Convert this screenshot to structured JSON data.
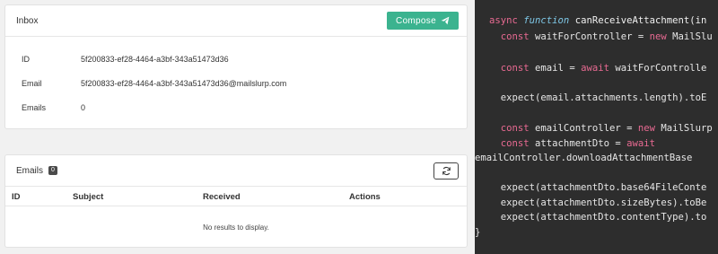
{
  "inbox": {
    "title": "Inbox",
    "compose_label": "Compose",
    "fields": [
      {
        "label": "ID",
        "value": "5f200833-ef28-4464-a3bf-343a51473d36"
      },
      {
        "label": "Email",
        "value": "5f200833-ef28-4464-a3bf-343a51473d36@mailslurp.com"
      },
      {
        "label": "Emails",
        "value": "0"
      }
    ]
  },
  "emails": {
    "title": "Emails",
    "count": "0",
    "columns": [
      "ID",
      "Subject",
      "Received",
      "Actions"
    ],
    "empty_text": "No results to display."
  },
  "code": {
    "lines": [
      "async function canReceiveAttachment(in",
      "  const waitForController = new MailSlu",
      "",
      "  const email = await waitForControlle",
      "",
      "  expect(email.attachments.length).toE",
      "",
      "  const emailController = new MailSlurp",
      "  const attachmentDto = await",
      "emailController.downloadAttachmentBase",
      "",
      "  expect(attachmentDto.base64FileConte",
      "  expect(attachmentDto.sizeBytes).toBe",
      "  expect(attachmentDto.contentType).to",
      "}"
    ]
  },
  "colors": {
    "accent": "#3bb38f",
    "code_bg": "#2d2d2d",
    "code_keyword": "#e86a92",
    "code_function": "#7ec7e6"
  },
  "icons": {
    "compose": "paper-plane-icon",
    "refresh": "refresh-icon"
  }
}
